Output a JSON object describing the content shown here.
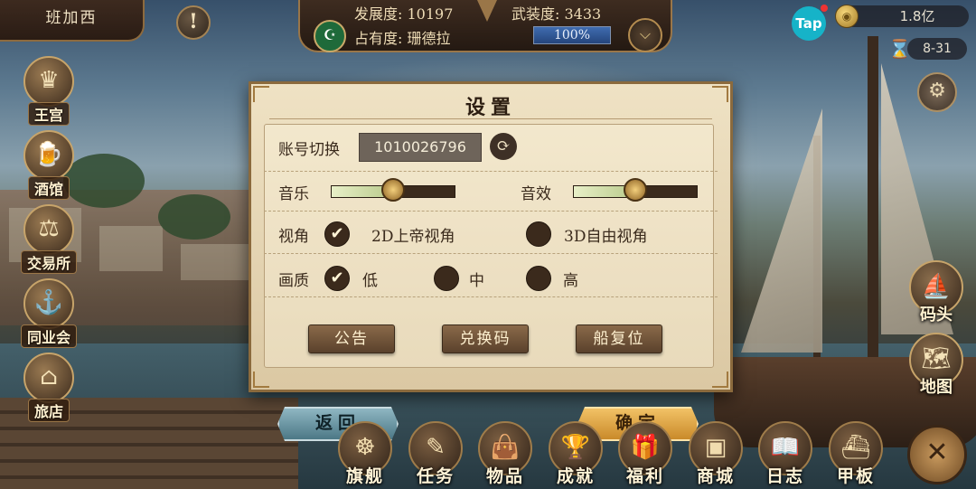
{
  "topbar": {
    "city_name": "班加西",
    "alert_icon": "!",
    "development_label": "发展度: 10197",
    "armament_label": "武装度: 3433",
    "occupancy_label": "占有度: 珊德拉",
    "occupancy_percent": "100%",
    "occupancy_value": 1.0,
    "tap_label": "Tap",
    "gold": "1.8亿",
    "date": "8-31"
  },
  "sidebar_left": [
    {
      "label": "王宫",
      "icon": "crown-icon",
      "glyph": "♛"
    },
    {
      "label": "酒馆",
      "icon": "beer-mug-icon",
      "glyph": "🍺"
    },
    {
      "label": "交易所",
      "icon": "scales-icon",
      "glyph": "⚖"
    },
    {
      "label": "同业会",
      "icon": "anchor-shield-icon",
      "glyph": "⚓"
    },
    {
      "label": "旅店",
      "icon": "inn-icon",
      "glyph": "⌂"
    }
  ],
  "sidebar_right": [
    {
      "label": "码头",
      "icon": "dock-icon",
      "glyph": "⛵"
    },
    {
      "label": "地图",
      "icon": "map-scroll-icon",
      "glyph": "🗺"
    }
  ],
  "dialog": {
    "title": "设置",
    "account_label": "账号切换",
    "account_id": "1010026796",
    "music_label": "音乐",
    "music_level": 0.5,
    "sfx_label": "音效",
    "sfx_level": 0.5,
    "view_label": "视角",
    "view_2d": "2D上帝视角",
    "view_3d": "3D自由视角",
    "view_selected": "2D上帝视角",
    "quality_label": "画质",
    "quality_low": "低",
    "quality_mid": "中",
    "quality_high": "高",
    "quality_selected": "低",
    "check_glyph": "✔",
    "buttons": {
      "notice": "公告",
      "redeem": "兑换码",
      "ship_reset": "船复位"
    }
  },
  "actions": {
    "back": "返回",
    "confirm": "确定"
  },
  "bottom_nav": [
    {
      "label": "旗舰",
      "icon": "ship-wheel-icon",
      "glyph": "☸"
    },
    {
      "label": "任务",
      "icon": "quest-scroll-icon",
      "glyph": "✎"
    },
    {
      "label": "物品",
      "icon": "bag-icon",
      "glyph": "👜"
    },
    {
      "label": "成就",
      "icon": "trophy-icon",
      "glyph": "🏆"
    },
    {
      "label": "福利",
      "icon": "gift-icon",
      "glyph": "🎁"
    },
    {
      "label": "商城",
      "icon": "chest-icon",
      "glyph": "▣"
    },
    {
      "label": "日志",
      "icon": "journal-icon",
      "glyph": "📖"
    },
    {
      "label": "甲板",
      "icon": "deck-ship-icon",
      "glyph": "⛴"
    }
  ],
  "colors": {
    "accent_gold": "#c7a46a",
    "panel_bg": "#efe2c4",
    "confirm_orange": "#f2c266",
    "back_teal": "#4c7886"
  }
}
